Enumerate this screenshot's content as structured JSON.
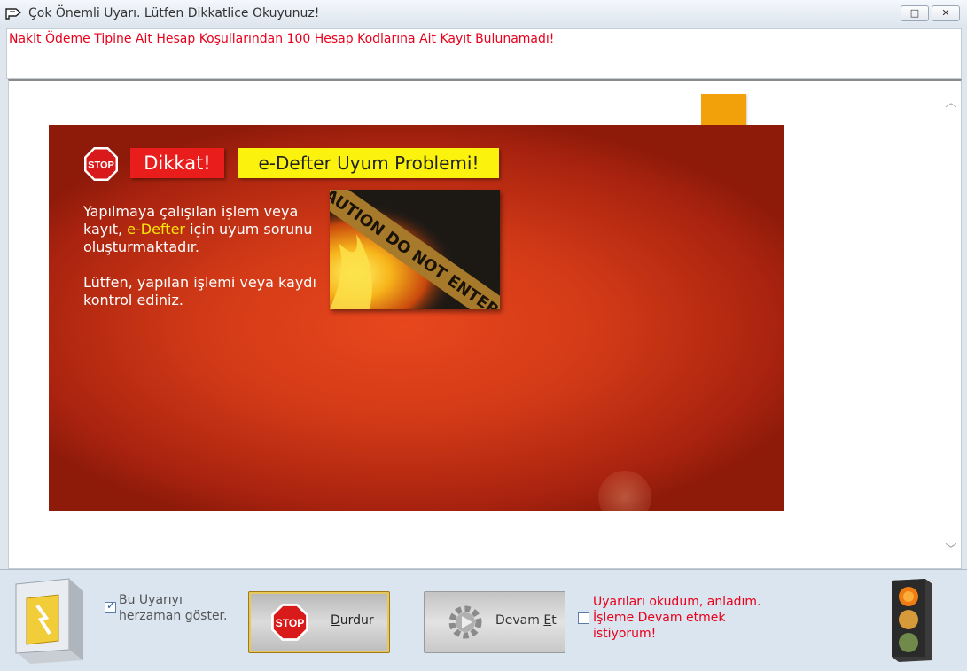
{
  "window": {
    "title": "Çok Önemli Uyarı. Lütfen Dikkatlice Okuyunuz!",
    "controls": {
      "maximize": "□",
      "close": "✕"
    }
  },
  "message": "Nakit Ödeme Tipine Ait Hesap Koşullarından 100 Hesap Kodlarına Ait Kayıt Bulunamadı!",
  "banner": {
    "stop_text": "STOP",
    "dikkat": "Dikkat!",
    "problem": "e-Defter Uyum Problemi!",
    "para1_a": "Yapılmaya çalışılan işlem veya kayıt, ",
    "para1_highlight": "e-Defter",
    "para1_b": " için uyum sorunu oluşturmaktadır.",
    "para2": "Lütfen, yapılan işlemi veya kaydı kontrol ediniz.",
    "tape_text": "CAUTION DO NOT ENTER",
    "colors": {
      "dikkat_bg": "#ea1d1d",
      "problem_bg": "#fbf30e",
      "highlight": "#fbe80a",
      "orange_tab": "#f2a10b"
    }
  },
  "bottom": {
    "show_always": {
      "label": "Bu Uyarıyı herzaman göster.",
      "checked": true
    },
    "stop_button": {
      "icon_text": "STOP",
      "pre": "",
      "accel": "D",
      "post": "urdur"
    },
    "continue_button": {
      "pre": "Devam ",
      "accel": "E",
      "post": "t"
    },
    "acknowledge": {
      "label": "Uyarıları okudum, anladım. İşleme Devam etmek istiyorum!",
      "checked": false
    }
  },
  "icons": [
    "app-icon",
    "stop-sign-icon",
    "safe-icon",
    "gear-play-icon",
    "traffic-light-icon"
  ]
}
